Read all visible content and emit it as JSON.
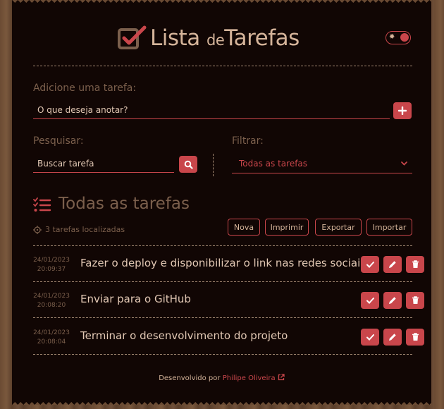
{
  "header": {
    "title_part1": "Lista",
    "title_connector": "de",
    "title_part2": "Tarefas",
    "logo_icon": "check-square-icon",
    "theme_toggle_icon": "sun-icon",
    "theme_toggle_on": true
  },
  "add_task": {
    "label": "Adicione uma tarefa:",
    "placeholder": "O que deseja anotar?",
    "button_icon": "plus-icon"
  },
  "search": {
    "label": "Pesquisar:",
    "placeholder": "Buscar tarefa",
    "button_icon": "search-icon"
  },
  "filter": {
    "label": "Filtrar:",
    "selected": "Todas as tarefas",
    "chevron_icon": "chevron-down-icon"
  },
  "list": {
    "title": "Todas as tarefas",
    "title_icon": "list-check-icon",
    "count_icon": "crosshair-icon",
    "count_text": "3 tarefas localizadas",
    "buttons": [
      "Nova",
      "Imprimir",
      "Exportar",
      "Importar"
    ],
    "tasks": [
      {
        "date": "24/01/2023",
        "time": "20:09:37",
        "text": "Fazer o deploy e disponibilizar o link nas redes sociais"
      },
      {
        "date": "24/01/2023",
        "time": "20:08:20",
        "text": "Enviar para o GitHub"
      },
      {
        "date": "24/01/2023",
        "time": "20:08:04",
        "text": "Terminar o desenvolvimento do projeto"
      }
    ],
    "action_icons": [
      "check-icon",
      "pencil-icon",
      "trash-icon"
    ]
  },
  "footer": {
    "prefix": "Desenvolvido por",
    "author": "Philipe Oliveira",
    "link_icon": "external-link-icon"
  },
  "colors": {
    "background": "#110604",
    "accent": "#c9464b",
    "text": "#d5b49a",
    "muted": "#7b5f4c"
  }
}
